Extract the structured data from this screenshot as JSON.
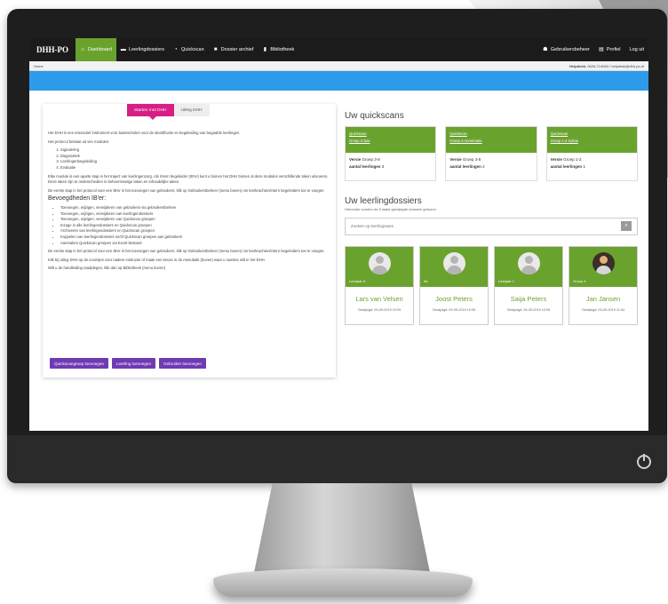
{
  "nav": {
    "brand": "DHH-PO",
    "items": [
      {
        "label": "Dashboard",
        "icon": "home-icon"
      },
      {
        "label": "Leerlingdossiers",
        "icon": "folder-icon"
      },
      {
        "label": "Quickscan",
        "icon": "gauge-icon"
      },
      {
        "label": "Dossier archief",
        "icon": "archive-icon"
      },
      {
        "label": "Bibliotheek",
        "icon": "book-icon"
      }
    ],
    "right": [
      {
        "label": "Gebruikersbeheer",
        "icon": "users-icon"
      },
      {
        "label": "Profiel",
        "icon": "profile-icon"
      },
      {
        "label": "Log uit",
        "icon": ""
      }
    ]
  },
  "breadcrumb": "Home",
  "helpdesk": {
    "label": "Helpdesk:",
    "text": "0626-714063 / helpdesk@dhh-po.nl"
  },
  "tabs": [
    "Starten met DHH",
    "Uitleg DHH"
  ],
  "intro": {
    "p1": "Het DHH is een interactief instrument voor basisscholen voor de identificatie en begeleiding van begaafde leerlingen.",
    "p2": "Het protocol bestaat uit vier modules:",
    "modules": [
      "Signalering",
      "Diagnostiek",
      "Leerlingenbegeleiding",
      "Evaluatie"
    ],
    "p3": "Elke module is een aparte stap in het traject van leerlingenzorg. Als Intern begeleider (IB'er) kunt u binnen het DHH binnen al deze modules verschillende taken uitvoeren. Deze taken zijn te onderscheiden in beheersmatige taken en inhoudelijke taken.",
    "p4": "De eerste stap in het protocol voor een IB'er is het toevoegen van gebruikers, klik op Gebruikersbeheer (menu boven) om leerkrachten/intern begeleiders toe te voegen.",
    "heading": "Bevoegdheden IB'er:",
    "rights": [
      "Toevoegen, wijzigen, verwijderen van gebruikers via gebruikersbeheer",
      "Toevoegen, wijzigen, verwijderen van leerlingendossiers",
      "Toevoegen, wijzigen, verwijderen van Quickscan groepen",
      "Inzage in alle leerlingendossiers en Quickscan groepen",
      "Archiveren van leerlingendossiers en Quickscan groepen",
      "Koppelen van leerlingendossiers en/of Quickscan groepen aan gebruikers",
      "Aanmaken Quickscan groepen via Excel-bestand"
    ],
    "p5": "De eerste stap in het protocol voor een IB'er is het toevoegen van gebruikers, klik op Gebruikersbeheer (menu boven) om leerkrachten/intern begeleiders toe te voegen.",
    "p6": "Klik bij uitleg DHH op de icoontjes voor nadere instructie of maak een keuze in de menubalk (boven) waar u naartoe wilt in het DHH.",
    "p7": "Wilt u de handleiding raadplegen, klik dan op Bibliotheek (menu boven)"
  },
  "buttons": [
    "Quickscangroep toevoegen",
    "Leerling toevoegen",
    "Gebruiker toevoegen"
  ],
  "quickscans": {
    "title": "Uw quickscans",
    "cards": [
      {
        "line1": "Quickscan",
        "line2": "Groep 5 Bas",
        "versie_label": "Versie",
        "versie": "Groep 3-8",
        "aantal_label": "aantal leerlingen",
        "aantal": "3"
      },
      {
        "line1": "Quickscan",
        "line2": "Groep 3 Annemarie",
        "versie_label": "Versie",
        "versie": "Groep 3-8",
        "aantal_label": "aantal leerlingen",
        "aantal": "2"
      },
      {
        "line1": "Quickscan",
        "line2": "Groep 1-2 Sylvia",
        "versie_label": "Versie",
        "versie": "Groep 1-2",
        "aantal_label": "aantal leerlingen",
        "aantal": "1"
      }
    ]
  },
  "dossiers": {
    "title": "Uw leerlingdossiers",
    "subtitle": "Hieronder worden de 8 laatst gewijzigde dossiers getoond",
    "search_placeholder": "Zoeken op leerlingnaam",
    "cards": [
      {
        "group": "Leerjaar 5",
        "name": "Lars van Velsen",
        "date": "Gewijzigd: 09-09-2019 10:09"
      },
      {
        "group": "5d",
        "name": "Joost Peters",
        "date": "Gewijzigd: 09-09-2019 10:05"
      },
      {
        "group": "Leerjaar 1",
        "name": "Saija Peters",
        "date": "Gewijzigd: 09-09-2019 10:05"
      },
      {
        "group": "Groep 4",
        "name": "Jan Jansen",
        "date": "Gewijzigd: 03-09-2019 11:54"
      }
    ]
  },
  "colors": {
    "green": "#6aa22e",
    "blue_banner": "#2e9bea",
    "magenta_tab": "#d61f86",
    "purple_button": "#6f3ab3",
    "navbar": "#1b1b1b"
  }
}
